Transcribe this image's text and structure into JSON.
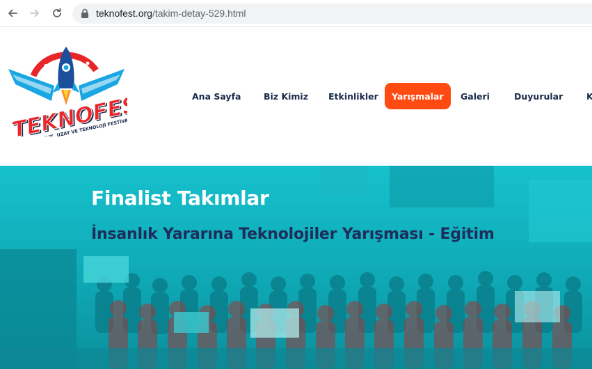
{
  "browser": {
    "url_domain": "teknofest.org",
    "url_path": "/takim-detay-529.html",
    "icons": [
      "back-arrow-icon",
      "forward-arrow-icon",
      "reload-icon",
      "lock-icon"
    ]
  },
  "logo": {
    "wordmark": "TEKNOFEST",
    "tagline": "HAVACILIK, UZAY VE TEKNOLOJİ FESTİVALİ"
  },
  "nav": {
    "items": [
      {
        "label": "Ana Sayfa",
        "active": false
      },
      {
        "label": "Biz Kimiz",
        "active": false
      },
      {
        "label": "Etkinlikler",
        "active": false
      },
      {
        "label": "Yarışmalar",
        "active": true
      },
      {
        "label": "Galeri",
        "active": false
      },
      {
        "label": "Duyurular",
        "active": false
      },
      {
        "label": "K",
        "active": false
      }
    ],
    "active_color": "#ff4a12",
    "text_color": "#1b2a4a"
  },
  "hero": {
    "title": "Finalist Takımlar",
    "subtitle": "İnsanlık Yararına Teknolojiler Yarışması - Eğitim",
    "overlay_color": "#10b6c2",
    "subtitle_color": "#1e2d5c"
  }
}
